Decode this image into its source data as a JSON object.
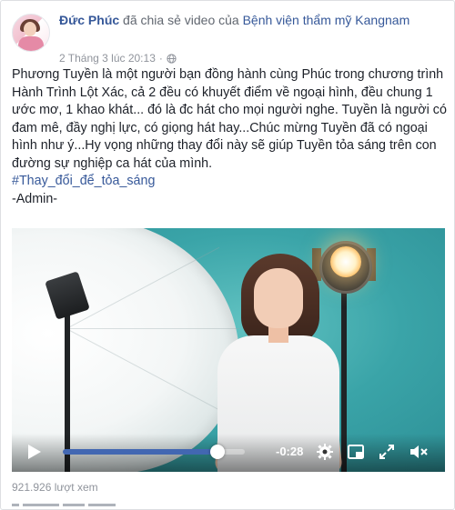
{
  "post": {
    "author": "Đức Phúc",
    "verb": "đã chia sẻ video của",
    "page_name": "Bệnh viện thẩm mỹ Kangnam",
    "timestamp": "2 Tháng 3 lúc 20:13",
    "separator": "·",
    "privacy_icon": "globe-icon",
    "body": "Phương Tuyền là một người bạn đồng hành cùng Phúc trong chương trình Hành Trình Lột Xác, cả 2 đều có khuyết điểm về ngoại hình, đều chung 1 ước mơ, 1 khao khát... đó là đc hát cho mọi người nghe. Tuyền là người có đam mê, đầy nghị lực, có giọng hát hay...Chúc mừng Tuyền đã có ngoại hình như ý...Hy vọng những thay đổi này sẽ giúp Tuyền tỏa sáng trên con đường sự nghiệp ca hát của mình.",
    "hashtag": "#Thay_đổi_để_tỏa_sáng",
    "signature": "-Admin-"
  },
  "video": {
    "time_remaining": "-0:28",
    "progress_fraction": 0.85,
    "icons": [
      "play-icon",
      "settings-gear-icon",
      "minimize-player-icon",
      "fullscreen-icon",
      "volume-muted-icon"
    ]
  },
  "views": "921.926 lượt xem",
  "colors": {
    "link": "#365899",
    "meta": "#90949c",
    "progress": "#4267b2"
  }
}
